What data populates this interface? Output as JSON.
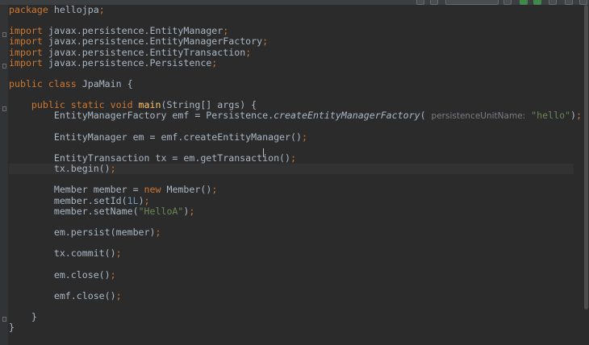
{
  "code": {
    "package": {
      "kw": "package",
      "name": "hellojpa"
    },
    "imports": [
      {
        "kw": "import",
        "path": "javax.persistence.EntityManager"
      },
      {
        "kw": "import",
        "path": "javax.persistence.EntityManagerFactory"
      },
      {
        "kw": "import",
        "path": "javax.persistence.EntityTransaction"
      },
      {
        "kw": "import",
        "path": "javax.persistence.Persistence"
      }
    ],
    "class_decl": {
      "kw": "public class",
      "name": "JpaMain"
    },
    "method_decl": {
      "kw": "public static void",
      "name": "main",
      "params": "(String[] args) {"
    },
    "emf_line": {
      "lhs": "EntityManagerFactory emf = Persistence.",
      "call": "createEntityManagerFactory",
      "hint": "persistenceUnitName:",
      "arg": "\"hello\""
    },
    "em_line": "EntityManager em = emf.createEntityManager()",
    "tx_line": "EntityTransaction tx = em.getTransaction()",
    "begin_line": "tx.begin()",
    "member_line": {
      "lhs": "Member member = ",
      "kw": "new",
      "rhs": " Member()"
    },
    "setid_line": {
      "call": "member.setId(",
      "num": "1L",
      "close": ")"
    },
    "setname_line": {
      "call": "member.setName(",
      "str": "\"HelloA\"",
      "close": ")"
    },
    "persist_line": "em.persist(member)",
    "commit_line": "tx.commit()",
    "em_close_line": "em.close()",
    "emf_close_line": "emf.close()",
    "semi": ";",
    "brace_open": "{",
    "brace_close": "}"
  }
}
